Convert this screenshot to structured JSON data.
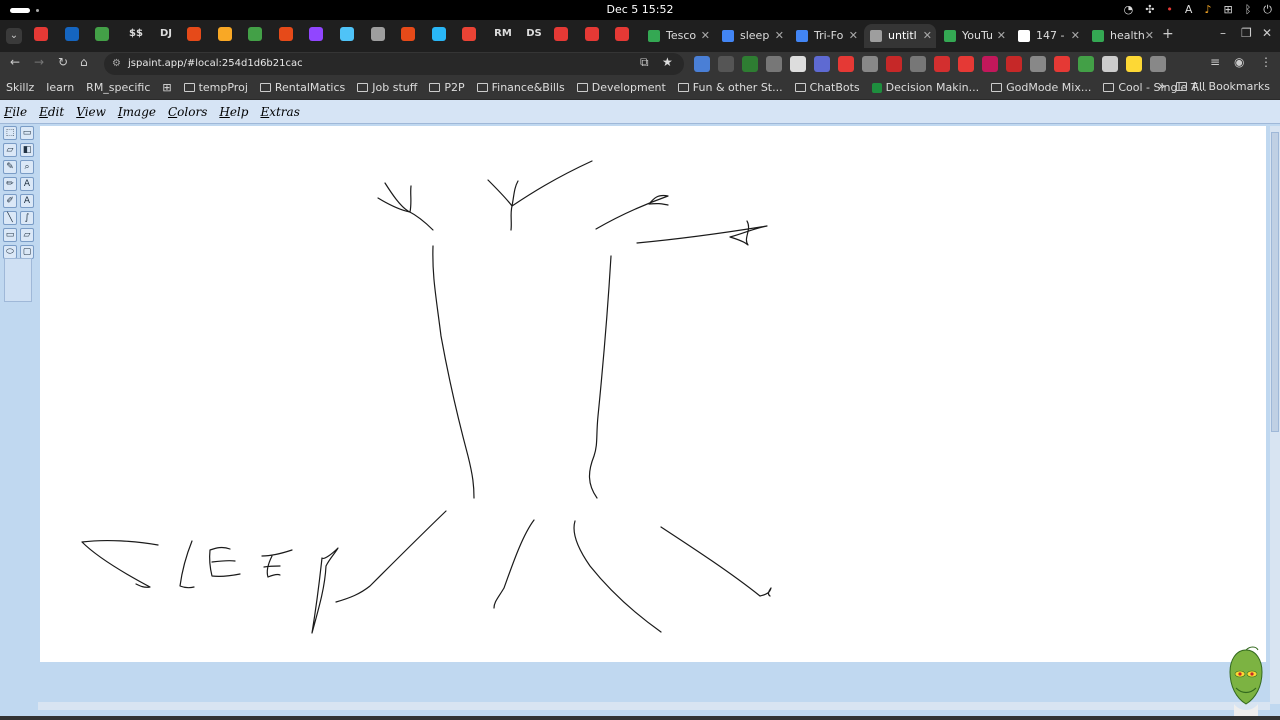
{
  "system": {
    "clock": "Dec 5  15:52"
  },
  "browser": {
    "pinned_tabs": [
      {
        "icon": "pdf-icon",
        "color": "#e53935",
        "label": ""
      },
      {
        "icon": "x-icon",
        "color": "#1565c0",
        "label": ""
      },
      {
        "icon": "check-icon",
        "color": "#43a047",
        "label": ""
      },
      {
        "icon": "text",
        "color": "",
        "label": "$$"
      },
      {
        "icon": "text",
        "color": "",
        "label": "DJ"
      },
      {
        "icon": "circle-icon",
        "color": "#e64a19",
        "label": ""
      },
      {
        "icon": "cross-icon",
        "color": "#f9a825",
        "label": ""
      },
      {
        "icon": "chat-icon",
        "color": "#43a047",
        "label": ""
      },
      {
        "icon": "ring-icon",
        "color": "#e64a19",
        "label": ""
      },
      {
        "icon": "twitch-icon",
        "color": "#9146ff",
        "label": ""
      },
      {
        "icon": "sparkle-icon",
        "color": "#4fc3f7",
        "label": ""
      },
      {
        "icon": "gear-icon",
        "color": "#9e9e9e",
        "label": ""
      },
      {
        "icon": "asterisk-icon",
        "color": "#e64a19",
        "label": ""
      },
      {
        "icon": "doc-icon",
        "color": "#29b6f6",
        "label": ""
      },
      {
        "icon": "gmail-icon",
        "color": "#ea4335",
        "label": ""
      },
      {
        "icon": "text",
        "color": "",
        "label": "RM"
      },
      {
        "icon": "text",
        "color": "",
        "label": "DS"
      },
      {
        "icon": "youtube-icon",
        "color": "#e53935",
        "label": ""
      },
      {
        "icon": "record-icon",
        "color": "#e53935",
        "label": ""
      },
      {
        "icon": "record-icon",
        "color": "#e53935",
        "label": ""
      }
    ],
    "tabs": [
      {
        "title": "Tesco",
        "icon": "drive-icon",
        "color": "#34a853",
        "active": false
      },
      {
        "title": "sleep",
        "icon": "docs-icon",
        "color": "#4285f4",
        "active": false
      },
      {
        "title": "Tri-Fo",
        "icon": "docs-icon",
        "color": "#4285f4",
        "active": false
      },
      {
        "title": "untitl",
        "icon": "jspaint-icon",
        "color": "#9e9e9e",
        "active": true
      },
      {
        "title": "YouTu",
        "icon": "sheets-icon",
        "color": "#34a853",
        "active": false
      },
      {
        "title": "147 -",
        "icon": "google-icon",
        "color": "#ffffff",
        "active": false
      },
      {
        "title": "health",
        "icon": "sheets-icon",
        "color": "#34a853",
        "active": false
      }
    ],
    "url": "jspaint.app/#local:254d1d6b21cac",
    "bookmarks": [
      {
        "label": "Skillz",
        "type": "link"
      },
      {
        "label": "learn",
        "type": "link"
      },
      {
        "label": "RM_specific",
        "type": "link"
      },
      {
        "label": "tempProj",
        "type": "folder"
      },
      {
        "label": "RentalMatics",
        "type": "folder"
      },
      {
        "label": "Job stuff",
        "type": "folder"
      },
      {
        "label": "P2P",
        "type": "folder"
      },
      {
        "label": "Finance&Bills",
        "type": "folder"
      },
      {
        "label": "Development",
        "type": "folder"
      },
      {
        "label": "Fun & other St...",
        "type": "folder"
      },
      {
        "label": "ChatBots",
        "type": "folder"
      },
      {
        "label": "Decision Makin...",
        "type": "sheet"
      },
      {
        "label": "GodMode Mix...",
        "type": "folder"
      },
      {
        "label": "Cool - Single T...",
        "type": "folder"
      }
    ],
    "all_bookmarks": "All Bookmarks",
    "extension_colors": [
      "#4a7fd6",
      "#555",
      "#2e7d32",
      "#777",
      "#ddd",
      "#5e6ad2",
      "#e53935",
      "#888",
      "#c62828",
      "#777",
      "#d32f2f",
      "#e53935",
      "#c2185b",
      "#c62828",
      "#888",
      "#e53935",
      "#43a047",
      "#ccc",
      "#fdd835",
      "#888"
    ]
  },
  "paint": {
    "menus": [
      "File",
      "Edit",
      "View",
      "Image",
      "Colors",
      "Help",
      "Extras"
    ],
    "tools": [
      "free-form-select",
      "select",
      "eraser",
      "fill",
      "pick-color",
      "magnifier",
      "pencil",
      "brush",
      "airbrush",
      "text",
      "line",
      "curve",
      "rectangle",
      "polygon",
      "ellipse",
      "rounded-rectangle"
    ],
    "drawing": {
      "ink_color": "#1a1a1a",
      "mascot": "grinch-icon"
    }
  }
}
